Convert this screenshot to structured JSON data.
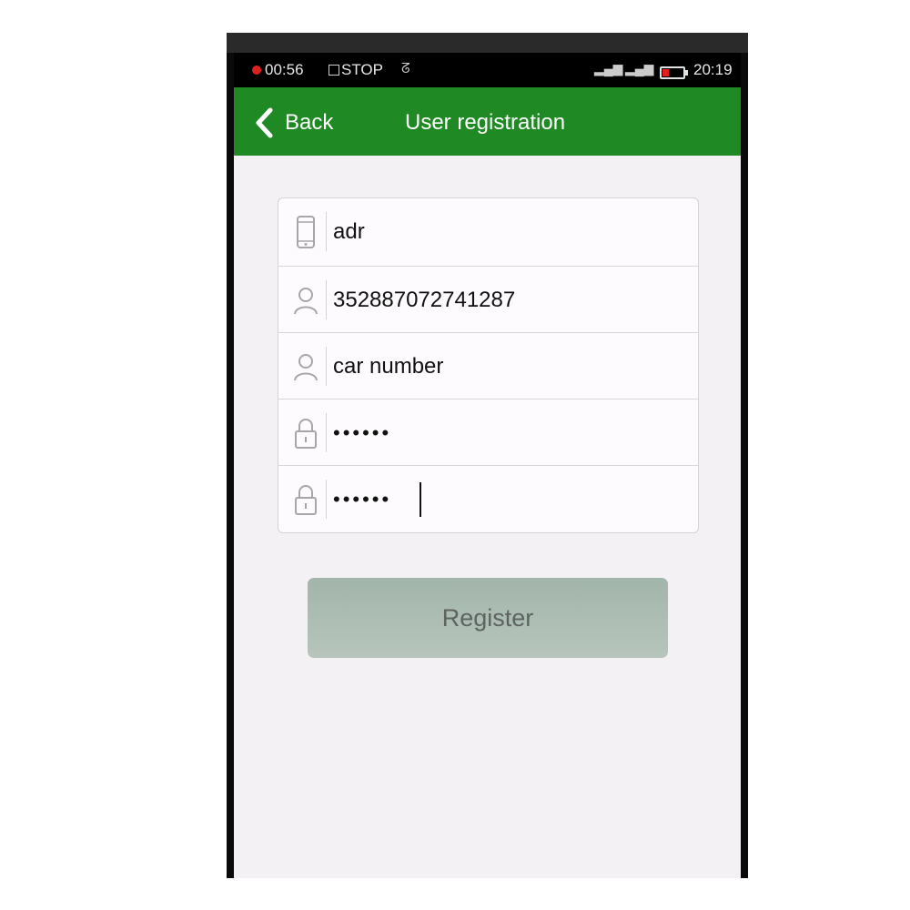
{
  "status_bar": {
    "record_time": "00:56",
    "stop_label": "STOP",
    "clock": "20:19"
  },
  "nav": {
    "back_label": "Back",
    "title": "User registration"
  },
  "form": {
    "fields": [
      {
        "icon": "phone-icon",
        "value": "adr",
        "type": "text"
      },
      {
        "icon": "user-icon",
        "value": "352887072741287",
        "type": "text"
      },
      {
        "icon": "user-icon",
        "value": "car number",
        "type": "text"
      },
      {
        "icon": "lock-icon",
        "value": "••••••",
        "type": "password"
      },
      {
        "icon": "lock-icon",
        "value": "••••••",
        "type": "password"
      }
    ]
  },
  "register_label": "Register",
  "colors": {
    "nav_green": "#1f8a24",
    "button_grey_green": "#a9bbb1",
    "page_bg": "#f3f1f4"
  }
}
